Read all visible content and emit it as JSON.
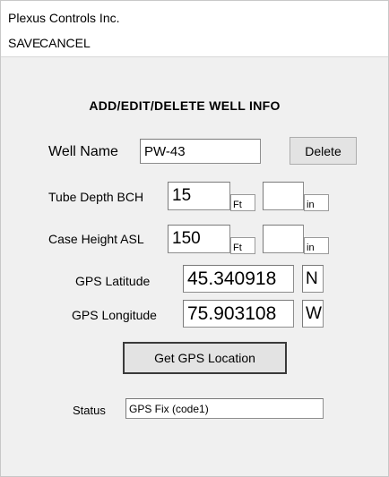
{
  "app": {
    "title": "Plexus Controls Inc."
  },
  "menu": {
    "save": "SAVE",
    "cancel": "CANCEL"
  },
  "form": {
    "heading": "ADD/EDIT/DELETE WELL INFO",
    "well_name": {
      "label": "Well Name",
      "value": "PW-43"
    },
    "delete_label": "Delete",
    "tube_depth": {
      "label": "Tube Depth BCH",
      "ft_value": "15",
      "ft_unit": "Ft",
      "in_value": "",
      "in_unit": "in"
    },
    "case_height": {
      "label": "Case Height ASL",
      "ft_value": "150",
      "ft_unit": "Ft",
      "in_value": "",
      "in_unit": "in"
    },
    "gps_latitude": {
      "label": "GPS Latitude",
      "value": "45.340918",
      "hemisphere": "N"
    },
    "gps_longitude": {
      "label": "GPS Longitude",
      "value": "75.903108",
      "hemisphere": "W"
    },
    "get_gps_label": "Get GPS Location",
    "status": {
      "label": "Status",
      "value": "GPS Fix (code1)"
    }
  }
}
